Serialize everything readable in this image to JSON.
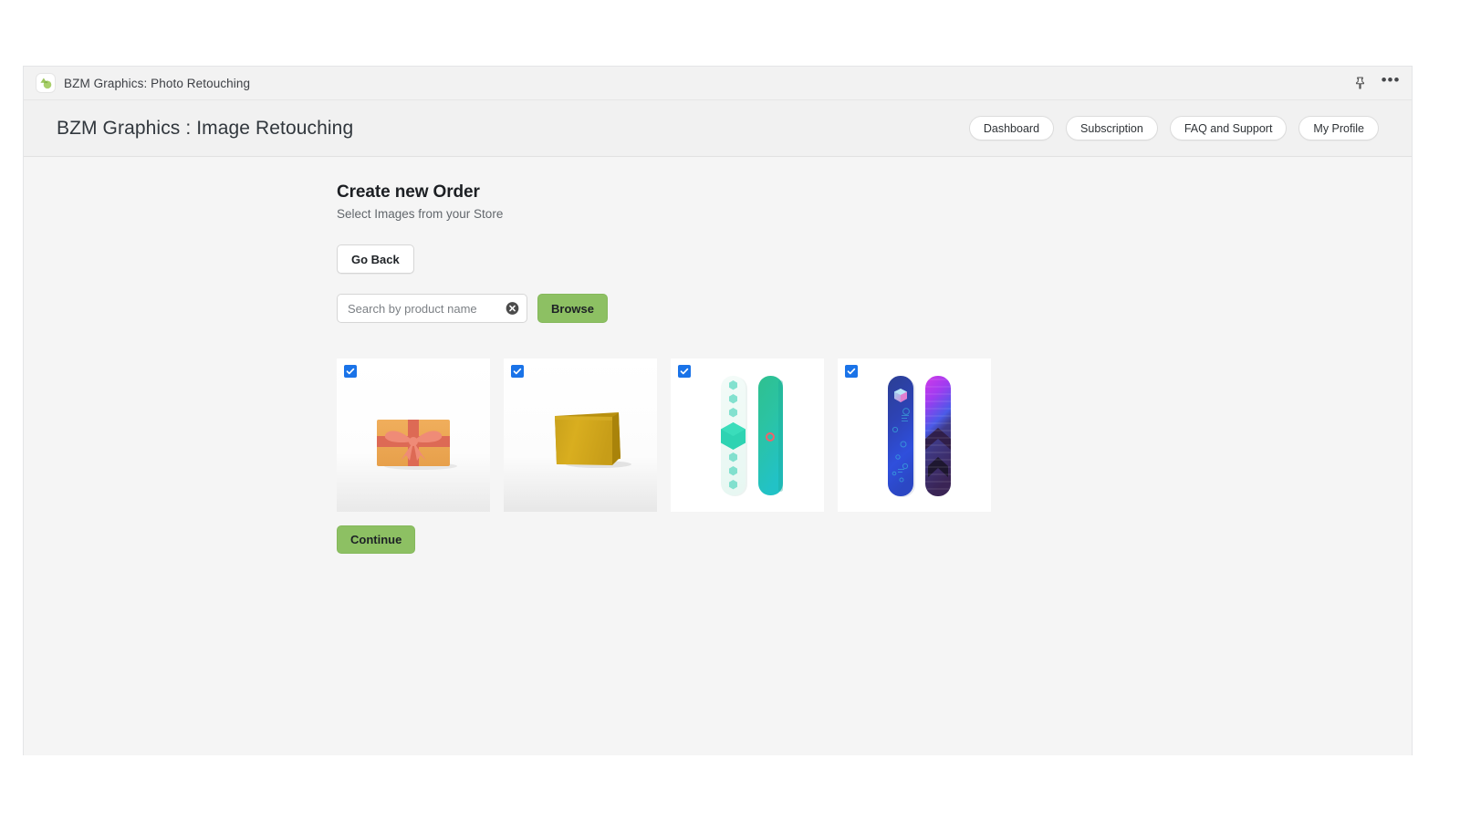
{
  "embed_bar": {
    "app_icon": "leaf-logo-icon",
    "title": "BZM Graphics: Photo Retouching",
    "pin_icon": "pin-icon",
    "more_icon": "more-options-icon"
  },
  "header": {
    "title": "BZM Graphics : Image Retouching",
    "nav": [
      {
        "label": "Dashboard"
      },
      {
        "label": "Subscription"
      },
      {
        "label": "FAQ and Support"
      },
      {
        "label": "My Profile"
      }
    ]
  },
  "main": {
    "page_title": "Create new Order",
    "page_subtitle": "Select Images from your Store",
    "go_back_label": "Go Back",
    "search": {
      "value": "",
      "placeholder": "Search by product name",
      "clear_icon": "clear-circle-icon"
    },
    "browse_label": "Browse",
    "continue_label": "Continue",
    "products": [
      {
        "name": "gift-card",
        "checked": true,
        "alt": "Gift Card"
      },
      {
        "name": "soap-bar",
        "checked": true,
        "alt": "Soap Bar"
      },
      {
        "name": "snowboard-teal",
        "checked": true,
        "alt": "Teal Snowboard Pair"
      },
      {
        "name": "snowboard-purple",
        "checked": true,
        "alt": "Blue and Purple Snowboard Pair"
      }
    ]
  },
  "colors": {
    "accent_green": "#8dc063",
    "checkbox_blue": "#1a73e8",
    "page_bg": "#f5f5f5",
    "header_bg": "#f1f1f1"
  }
}
